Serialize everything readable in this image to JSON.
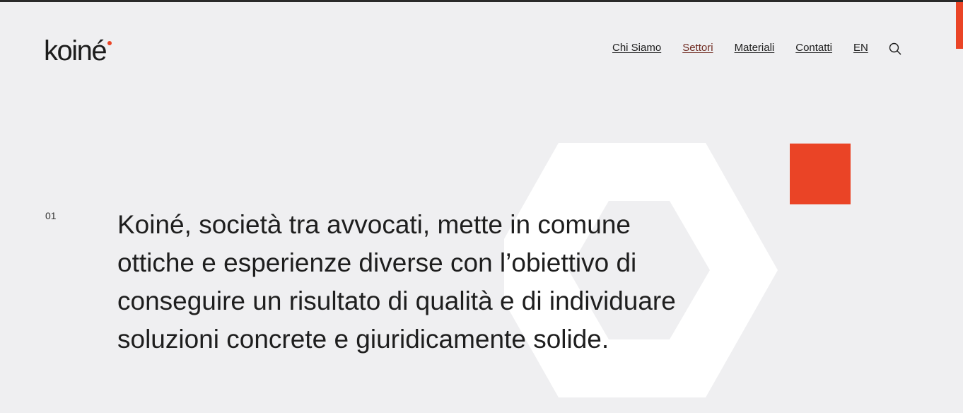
{
  "brand": {
    "logo_text": "koiné",
    "accent_color": "#ea4426"
  },
  "nav": {
    "items": [
      {
        "label": "Chi Siamo"
      },
      {
        "label": "Settori"
      },
      {
        "label": "Materiali"
      },
      {
        "label": "Contatti"
      },
      {
        "label": "EN"
      }
    ],
    "search_icon": "search-icon"
  },
  "intro": {
    "section_number": "01",
    "text": "Koiné, società tra avvocati, mette in comune ottiche e esperienze diverse con l’obiettivo di conseguire un risultato di qualità e di individuare soluzioni concrete e giuridicamente solide."
  }
}
